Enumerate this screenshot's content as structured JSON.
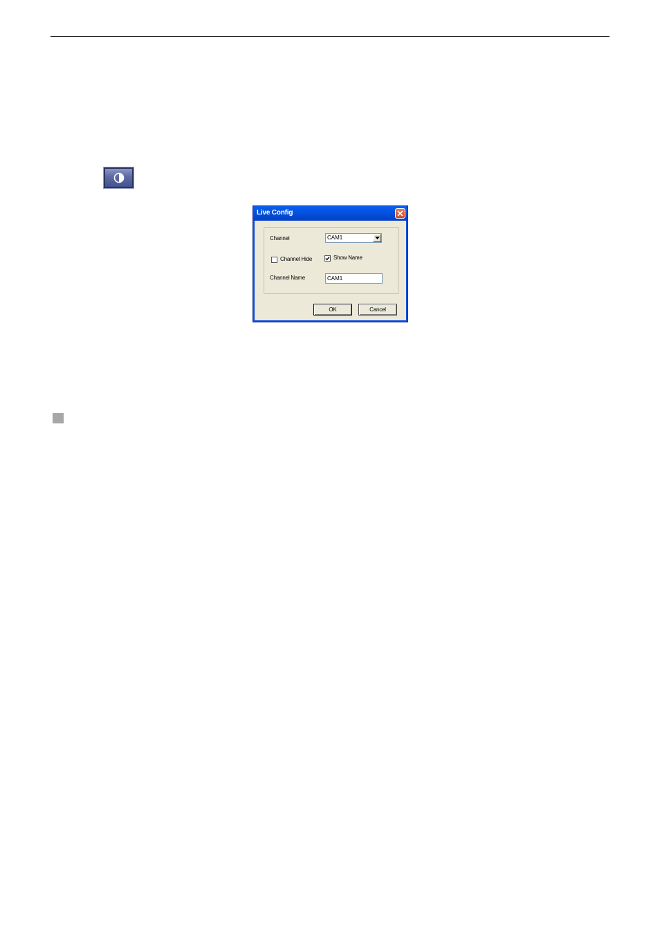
{
  "icons": {
    "contrast": "contrast-icon",
    "close": "close-icon",
    "dropdown": "chevron-down-icon",
    "check": "checkmark-icon"
  },
  "colors": {
    "titlebar": "#0453e0",
    "dialog_bg": "#ece9d8",
    "close_button": "#d34a24",
    "contrast_button": "#5b6aa3",
    "bullet": "#a7a7a7"
  },
  "dialog": {
    "title": "Live Config",
    "channel_label": "Channel",
    "channel_value": "CAM1",
    "channel_hide_label": "Channel Hide",
    "channel_hide_checked": false,
    "show_name_label": "Show Name",
    "show_name_checked": true,
    "channel_name_label": "Channel Name",
    "channel_name_value": "CAM1",
    "ok_label": "OK",
    "cancel_label": "Cancel"
  }
}
